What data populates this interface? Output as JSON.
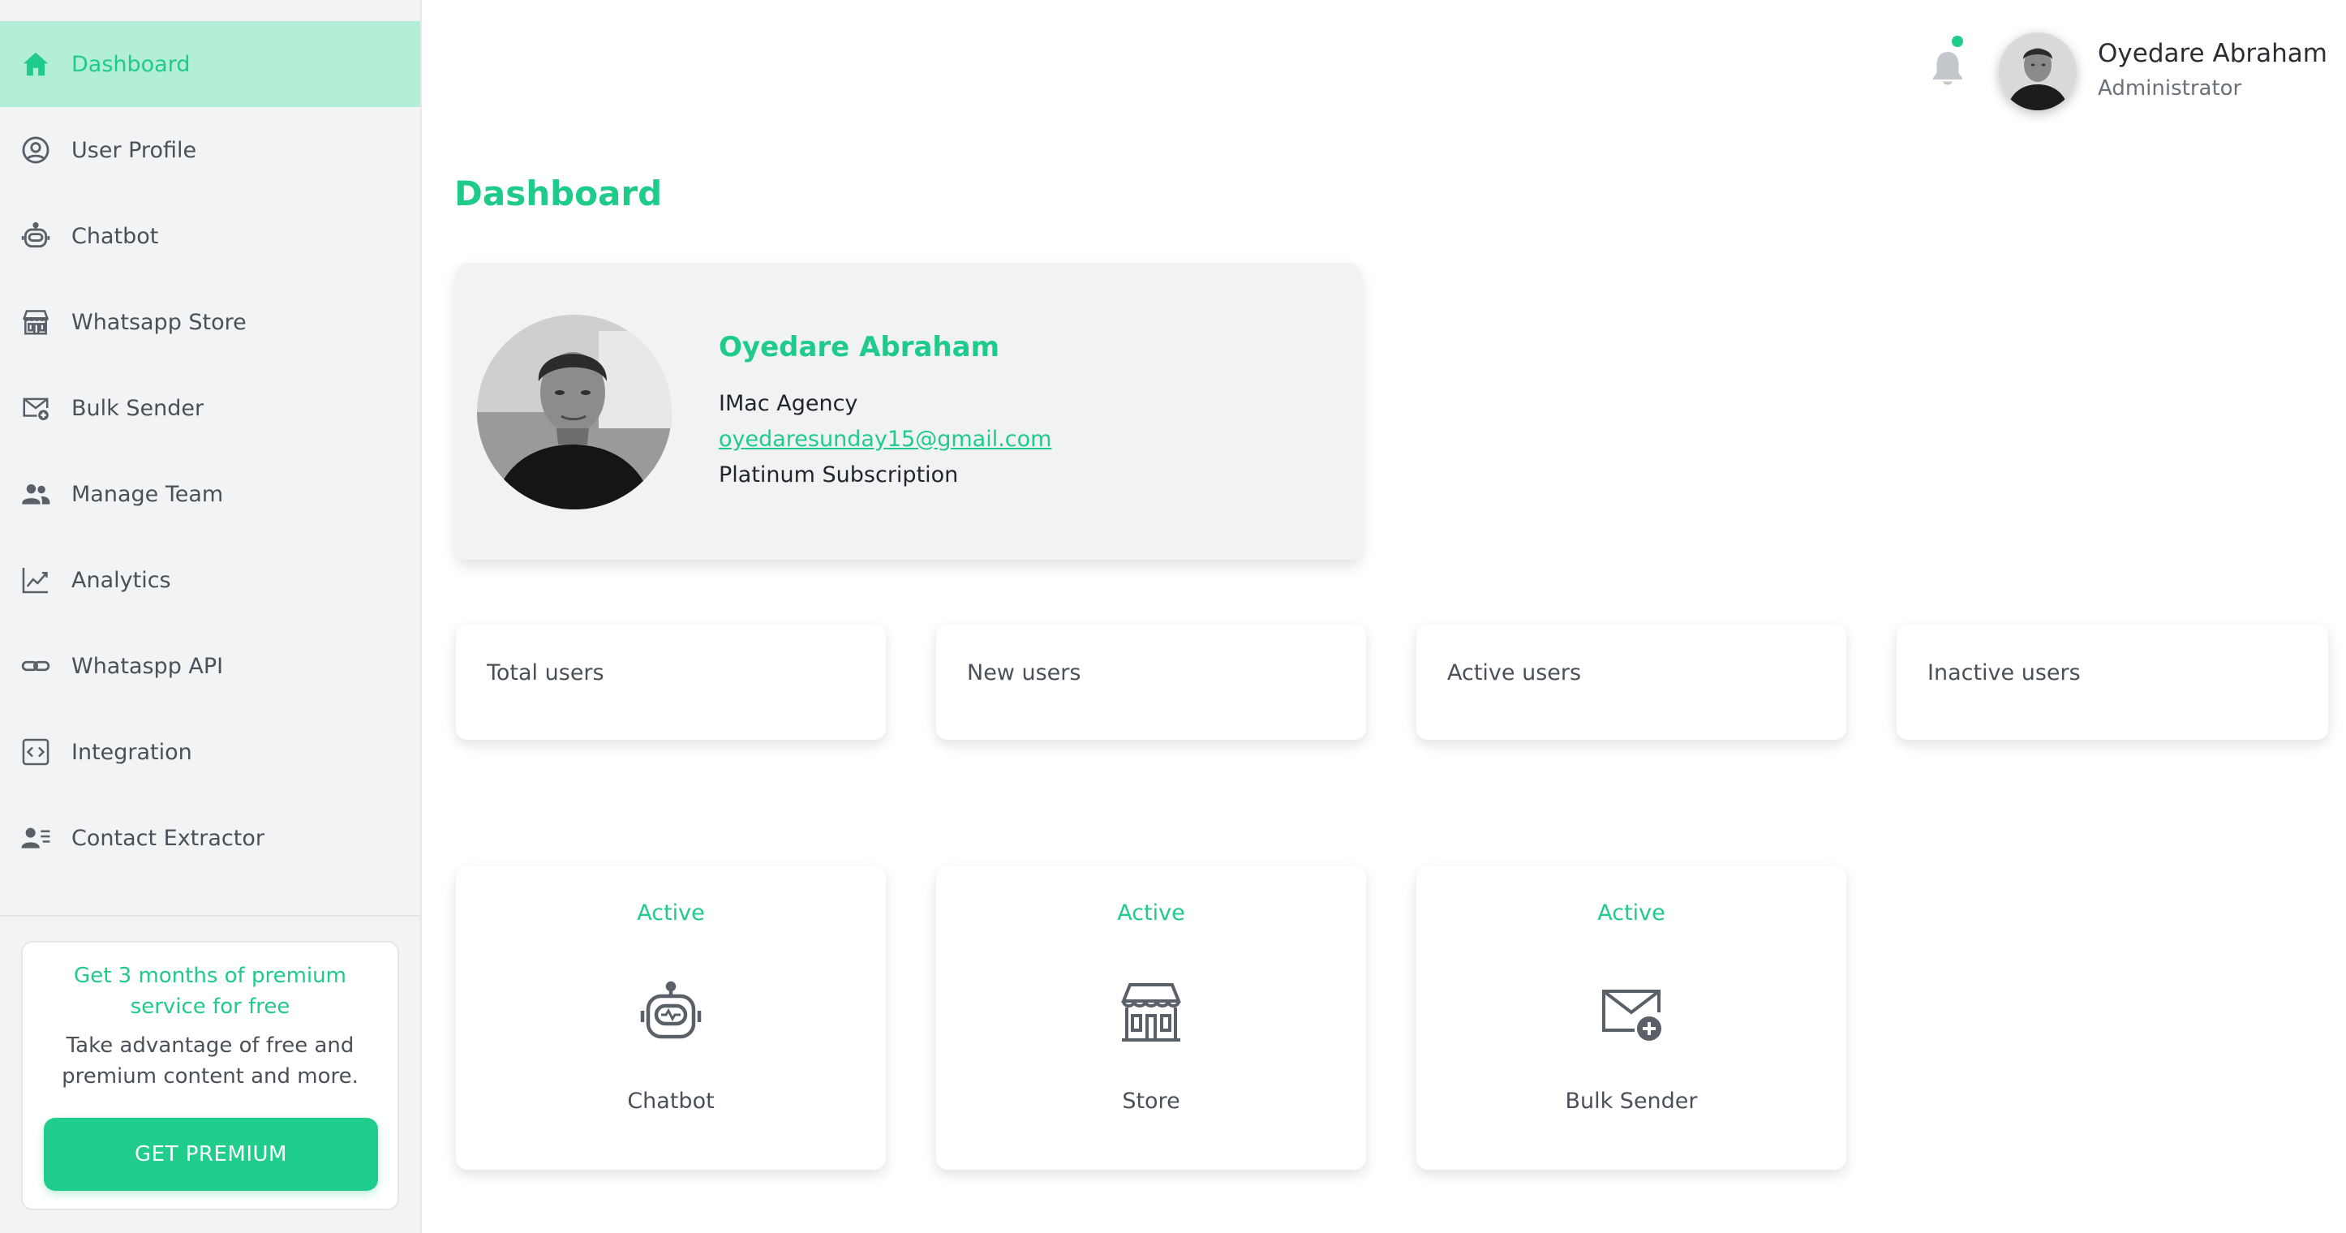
{
  "sidebar": {
    "items": [
      {
        "label": "Dashboard",
        "icon": "home-icon",
        "active": true
      },
      {
        "label": "User Profile",
        "icon": "user-circle-icon",
        "active": false
      },
      {
        "label": "Chatbot",
        "icon": "robot-icon",
        "active": false
      },
      {
        "label": "Whatsapp Store",
        "icon": "store-icon",
        "active": false
      },
      {
        "label": "Bulk Sender",
        "icon": "mail-plus-icon",
        "active": false
      },
      {
        "label": "Manage Team",
        "icon": "team-icon",
        "active": false
      },
      {
        "label": "Analytics",
        "icon": "chart-line-icon",
        "active": false
      },
      {
        "label": "Whataspp API",
        "icon": "link-icon",
        "active": false
      },
      {
        "label": "Integration",
        "icon": "code-icon",
        "active": false
      },
      {
        "label": "Contact Extractor",
        "icon": "contact-list-icon",
        "active": false
      }
    ],
    "promo": {
      "title": "Get 3 months of premium service for free",
      "text": "Take advantage of free and premium content and more.",
      "button": "GET PREMIUM"
    }
  },
  "header": {
    "user_name": "Oyedare Abraham",
    "user_role": "Administrator",
    "notification_dot": true
  },
  "main": {
    "title": "Dashboard",
    "profile": {
      "name": "Oyedare Abraham",
      "company": "IMac Agency",
      "email": "oyedaresunday15@gmail.com",
      "subscription": "Platinum Subscription"
    },
    "stats": [
      {
        "label": "Total users"
      },
      {
        "label": "New users"
      },
      {
        "label": "Active users"
      },
      {
        "label": "Inactive users"
      }
    ],
    "services": [
      {
        "status": "Active",
        "label": "Chatbot",
        "icon": "robot-icon"
      },
      {
        "status": "Active",
        "label": "Store",
        "icon": "store-icon"
      },
      {
        "status": "Active",
        "label": "Bulk Sender",
        "icon": "mail-plus-icon"
      }
    ]
  },
  "colors": {
    "accent": "#1fcb8b",
    "active_bg": "#b3efd7",
    "sidebar_bg": "#f2f3f4",
    "text": "#4a5058"
  }
}
